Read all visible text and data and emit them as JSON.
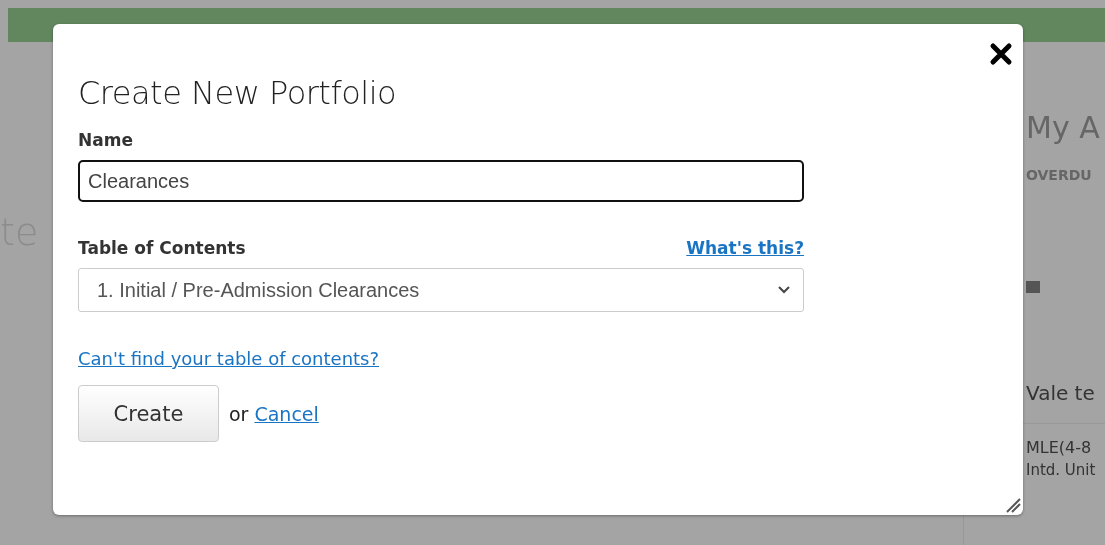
{
  "background": {
    "left_text": "te",
    "right_heading": "My A",
    "overdue_label": "OVERDU",
    "section_title": "Vale te",
    "row_text": "MLE(4-8",
    "row_subtext": "Intd. Unit"
  },
  "dialog": {
    "title": "Create New Portfolio",
    "name_field": {
      "label": "Name",
      "value": "Clearances"
    },
    "toc_field": {
      "label": "Table of Contents",
      "help_link": "What's this?",
      "value": "1. Initial / Pre-Admission Clearances"
    },
    "find_link": "Can't find your table of contents?",
    "create_button": "Create",
    "or_text": "or",
    "cancel_link": "Cancel"
  }
}
